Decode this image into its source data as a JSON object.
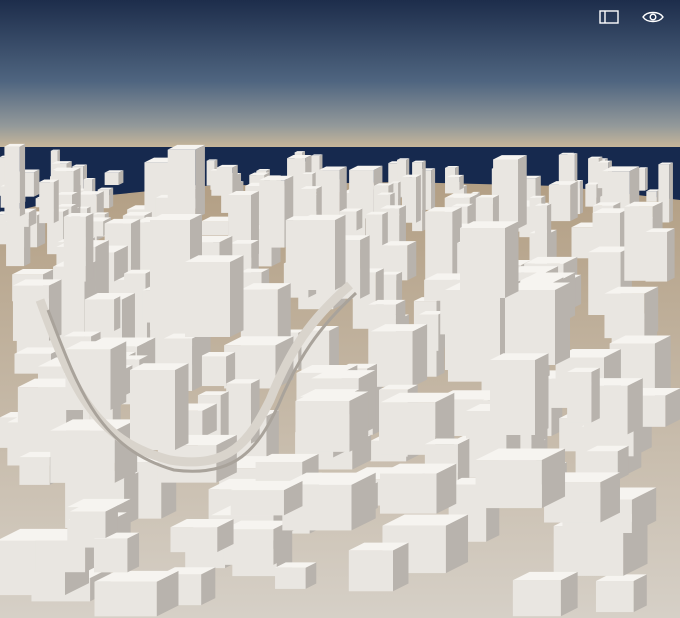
{
  "viewport": {
    "kind": "3d-city-viewport",
    "sky_colors": {
      "top": "#1d2d4b",
      "mid": "#5b6f87",
      "horizon": "#c9b79a"
    },
    "sea_color": "#16294e",
    "ground_color": "#b9a88e",
    "building_color": "#e9e6e1",
    "building_shadow": "#b8b3ad"
  },
  "toolbar": {
    "panel_toggle": {
      "icon": "panel-toggle-icon",
      "color": "#ffffff"
    },
    "visibility_toggle": {
      "icon": "eye-icon",
      "color": "#ffffff"
    }
  }
}
